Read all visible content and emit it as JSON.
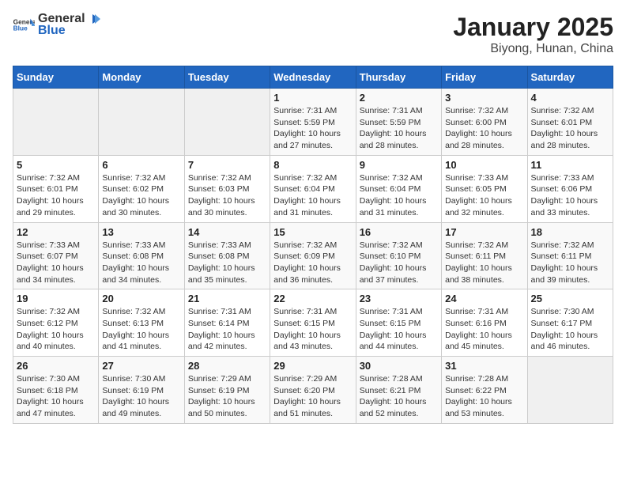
{
  "header": {
    "logo_general": "General",
    "logo_blue": "Blue",
    "title": "January 2025",
    "subtitle": "Biyong, Hunan, China"
  },
  "weekdays": [
    "Sunday",
    "Monday",
    "Tuesday",
    "Wednesday",
    "Thursday",
    "Friday",
    "Saturday"
  ],
  "weeks": [
    [
      {
        "day": "",
        "empty": true
      },
      {
        "day": "",
        "empty": true
      },
      {
        "day": "",
        "empty": true
      },
      {
        "day": "1",
        "sunrise": "7:31 AM",
        "sunset": "5:59 PM",
        "daylight": "10 hours and 27 minutes."
      },
      {
        "day": "2",
        "sunrise": "7:31 AM",
        "sunset": "5:59 PM",
        "daylight": "10 hours and 28 minutes."
      },
      {
        "day": "3",
        "sunrise": "7:32 AM",
        "sunset": "6:00 PM",
        "daylight": "10 hours and 28 minutes."
      },
      {
        "day": "4",
        "sunrise": "7:32 AM",
        "sunset": "6:01 PM",
        "daylight": "10 hours and 28 minutes."
      }
    ],
    [
      {
        "day": "5",
        "sunrise": "7:32 AM",
        "sunset": "6:01 PM",
        "daylight": "10 hours and 29 minutes."
      },
      {
        "day": "6",
        "sunrise": "7:32 AM",
        "sunset": "6:02 PM",
        "daylight": "10 hours and 30 minutes."
      },
      {
        "day": "7",
        "sunrise": "7:32 AM",
        "sunset": "6:03 PM",
        "daylight": "10 hours and 30 minutes."
      },
      {
        "day": "8",
        "sunrise": "7:32 AM",
        "sunset": "6:04 PM",
        "daylight": "10 hours and 31 minutes."
      },
      {
        "day": "9",
        "sunrise": "7:32 AM",
        "sunset": "6:04 PM",
        "daylight": "10 hours and 31 minutes."
      },
      {
        "day": "10",
        "sunrise": "7:33 AM",
        "sunset": "6:05 PM",
        "daylight": "10 hours and 32 minutes."
      },
      {
        "day": "11",
        "sunrise": "7:33 AM",
        "sunset": "6:06 PM",
        "daylight": "10 hours and 33 minutes."
      }
    ],
    [
      {
        "day": "12",
        "sunrise": "7:33 AM",
        "sunset": "6:07 PM",
        "daylight": "10 hours and 34 minutes."
      },
      {
        "day": "13",
        "sunrise": "7:33 AM",
        "sunset": "6:08 PM",
        "daylight": "10 hours and 34 minutes."
      },
      {
        "day": "14",
        "sunrise": "7:33 AM",
        "sunset": "6:08 PM",
        "daylight": "10 hours and 35 minutes."
      },
      {
        "day": "15",
        "sunrise": "7:32 AM",
        "sunset": "6:09 PM",
        "daylight": "10 hours and 36 minutes."
      },
      {
        "day": "16",
        "sunrise": "7:32 AM",
        "sunset": "6:10 PM",
        "daylight": "10 hours and 37 minutes."
      },
      {
        "day": "17",
        "sunrise": "7:32 AM",
        "sunset": "6:11 PM",
        "daylight": "10 hours and 38 minutes."
      },
      {
        "day": "18",
        "sunrise": "7:32 AM",
        "sunset": "6:11 PM",
        "daylight": "10 hours and 39 minutes."
      }
    ],
    [
      {
        "day": "19",
        "sunrise": "7:32 AM",
        "sunset": "6:12 PM",
        "daylight": "10 hours and 40 minutes."
      },
      {
        "day": "20",
        "sunrise": "7:32 AM",
        "sunset": "6:13 PM",
        "daylight": "10 hours and 41 minutes."
      },
      {
        "day": "21",
        "sunrise": "7:31 AM",
        "sunset": "6:14 PM",
        "daylight": "10 hours and 42 minutes."
      },
      {
        "day": "22",
        "sunrise": "7:31 AM",
        "sunset": "6:15 PM",
        "daylight": "10 hours and 43 minutes."
      },
      {
        "day": "23",
        "sunrise": "7:31 AM",
        "sunset": "6:15 PM",
        "daylight": "10 hours and 44 minutes."
      },
      {
        "day": "24",
        "sunrise": "7:31 AM",
        "sunset": "6:16 PM",
        "daylight": "10 hours and 45 minutes."
      },
      {
        "day": "25",
        "sunrise": "7:30 AM",
        "sunset": "6:17 PM",
        "daylight": "10 hours and 46 minutes."
      }
    ],
    [
      {
        "day": "26",
        "sunrise": "7:30 AM",
        "sunset": "6:18 PM",
        "daylight": "10 hours and 47 minutes."
      },
      {
        "day": "27",
        "sunrise": "7:30 AM",
        "sunset": "6:19 PM",
        "daylight": "10 hours and 49 minutes."
      },
      {
        "day": "28",
        "sunrise": "7:29 AM",
        "sunset": "6:19 PM",
        "daylight": "10 hours and 50 minutes."
      },
      {
        "day": "29",
        "sunrise": "7:29 AM",
        "sunset": "6:20 PM",
        "daylight": "10 hours and 51 minutes."
      },
      {
        "day": "30",
        "sunrise": "7:28 AM",
        "sunset": "6:21 PM",
        "daylight": "10 hours and 52 minutes."
      },
      {
        "day": "31",
        "sunrise": "7:28 AM",
        "sunset": "6:22 PM",
        "daylight": "10 hours and 53 minutes."
      },
      {
        "day": "",
        "empty": true
      }
    ]
  ]
}
